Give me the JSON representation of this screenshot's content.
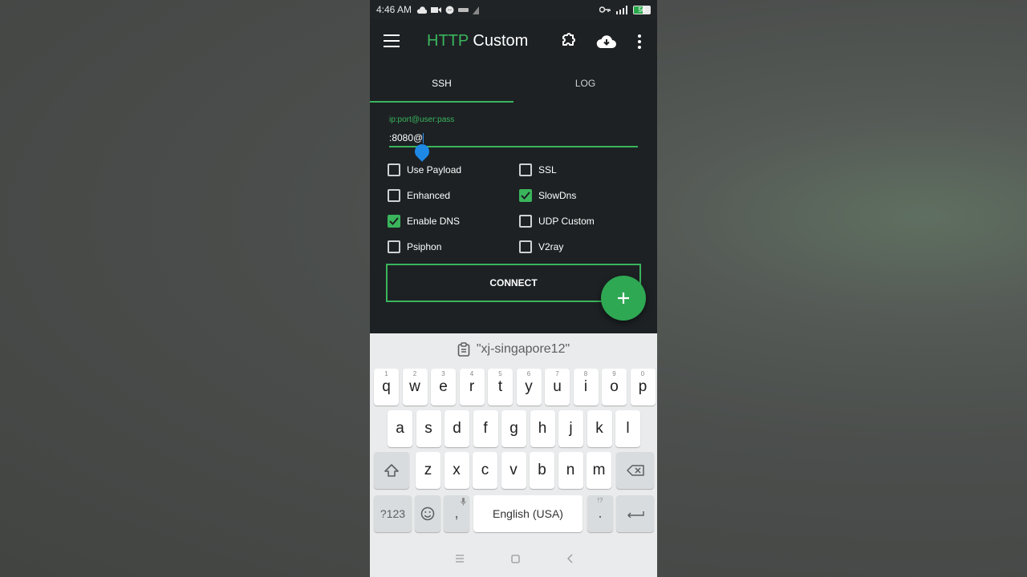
{
  "status_bar": {
    "time": "4:46 AM",
    "battery": "56",
    "battery_level": 0.56
  },
  "app": {
    "title_accent": "HTTP",
    "title_rest": "Custom"
  },
  "tabs": [
    {
      "label": "SSH",
      "active": true
    },
    {
      "label": "LOG",
      "active": false
    }
  ],
  "field": {
    "label": "ip:port@user:pass",
    "value": ":8080@"
  },
  "checkboxes": [
    {
      "label": "Use Payload",
      "checked": false
    },
    {
      "label": "SSL",
      "checked": false
    },
    {
      "label": "Enhanced",
      "checked": false
    },
    {
      "label": "SlowDns",
      "checked": true
    },
    {
      "label": "Enable DNS",
      "checked": true
    },
    {
      "label": "UDP Custom",
      "checked": false
    },
    {
      "label": "Psiphon",
      "checked": false
    },
    {
      "label": "V2ray",
      "checked": false
    }
  ],
  "connect_label": "CONNECT",
  "fab_label": "+",
  "keyboard": {
    "clipboard": "\"xj-singapore12\"",
    "row1": [
      {
        "k": "q",
        "h": "1"
      },
      {
        "k": "w",
        "h": "2"
      },
      {
        "k": "e",
        "h": "3"
      },
      {
        "k": "r",
        "h": "4"
      },
      {
        "k": "t",
        "h": "5"
      },
      {
        "k": "y",
        "h": "6"
      },
      {
        "k": "u",
        "h": "7"
      },
      {
        "k": "i",
        "h": "8"
      },
      {
        "k": "o",
        "h": "9"
      },
      {
        "k": "p",
        "h": "0"
      }
    ],
    "row2": [
      "a",
      "s",
      "d",
      "f",
      "g",
      "h",
      "j",
      "k",
      "l"
    ],
    "row3": [
      "z",
      "x",
      "c",
      "v",
      "b",
      "n",
      "m"
    ],
    "sym_label": "?123",
    "comma": ",",
    "space_label": "English (USA)",
    "period": ".",
    "period_hint": "!?"
  },
  "colors": {
    "accent": "#3ab55c",
    "background": "#1d2124",
    "keyboard": "#e9ebec"
  },
  "icons": [
    "menu-icon",
    "puzzle-icon",
    "cloud-download-icon",
    "more-vert-icon",
    "plus-icon",
    "clipboard-icon",
    "shift-icon",
    "backspace-icon",
    "emoji-icon",
    "mic-icon",
    "enter-icon"
  ]
}
